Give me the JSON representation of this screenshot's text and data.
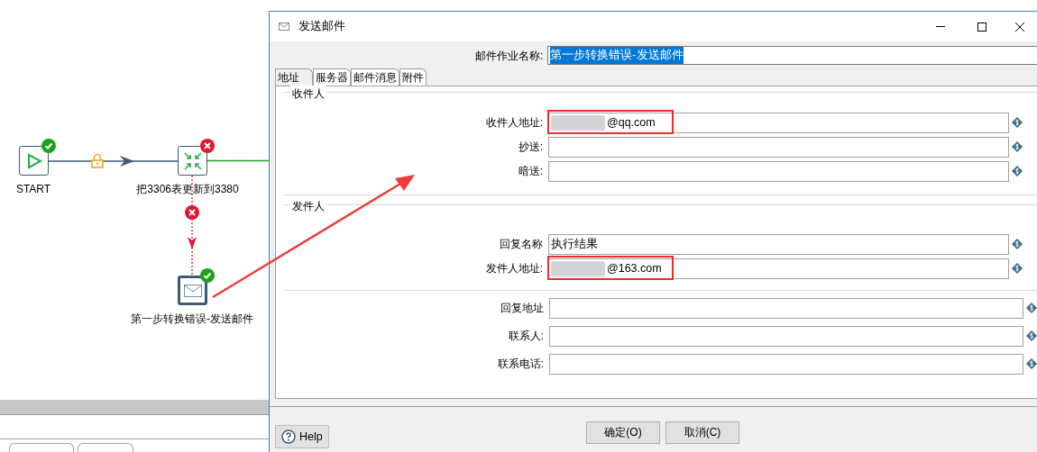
{
  "window": {
    "title": "发送邮件"
  },
  "job_name": {
    "label": "邮件作业名称:",
    "value": "第一步转换错误-发送邮件"
  },
  "tabs": [
    {
      "label": "地址",
      "selected": true
    },
    {
      "label": "服务器",
      "selected": false
    },
    {
      "label": "邮件消息",
      "selected": false
    },
    {
      "label": "附件",
      "selected": false
    }
  ],
  "groups": [
    {
      "title": "收件人",
      "fields": [
        {
          "label": "收件人地址:",
          "value": "@qq.com",
          "redacted": true,
          "highlighted": true
        },
        {
          "label": "抄送:",
          "redacted": false,
          "highlighted": false
        },
        {
          "label": "暗送:",
          "redacted": false,
          "highlighted": false
        }
      ]
    },
    {
      "title": "发件人",
      "fields": [
        {
          "label": "回复名称",
          "value": "执行结果",
          "redacted": false,
          "highlighted": false
        },
        {
          "label": "发件人地址:",
          "value": "@163.com",
          "redacted": true,
          "highlighted": true
        }
      ]
    }
  ],
  "extra_fields": [
    {
      "label": "回复地址"
    },
    {
      "label": "联系人:"
    },
    {
      "label": "联系电话:"
    }
  ],
  "buttons": [
    {
      "label": "确定(O)"
    },
    {
      "label": "取消(C)"
    }
  ],
  "help": {
    "label": "Help"
  },
  "canvas": {
    "nodes": [
      {
        "kind": "start",
        "label": "START",
        "failed": false,
        "selected": false
      },
      {
        "kind": "transform",
        "label": "把3306表更新到3380",
        "failed": true,
        "selected": false
      },
      {
        "kind": "mail",
        "label": "第一步转换错误-发送邮件",
        "failed": false,
        "selected": true
      }
    ]
  }
}
